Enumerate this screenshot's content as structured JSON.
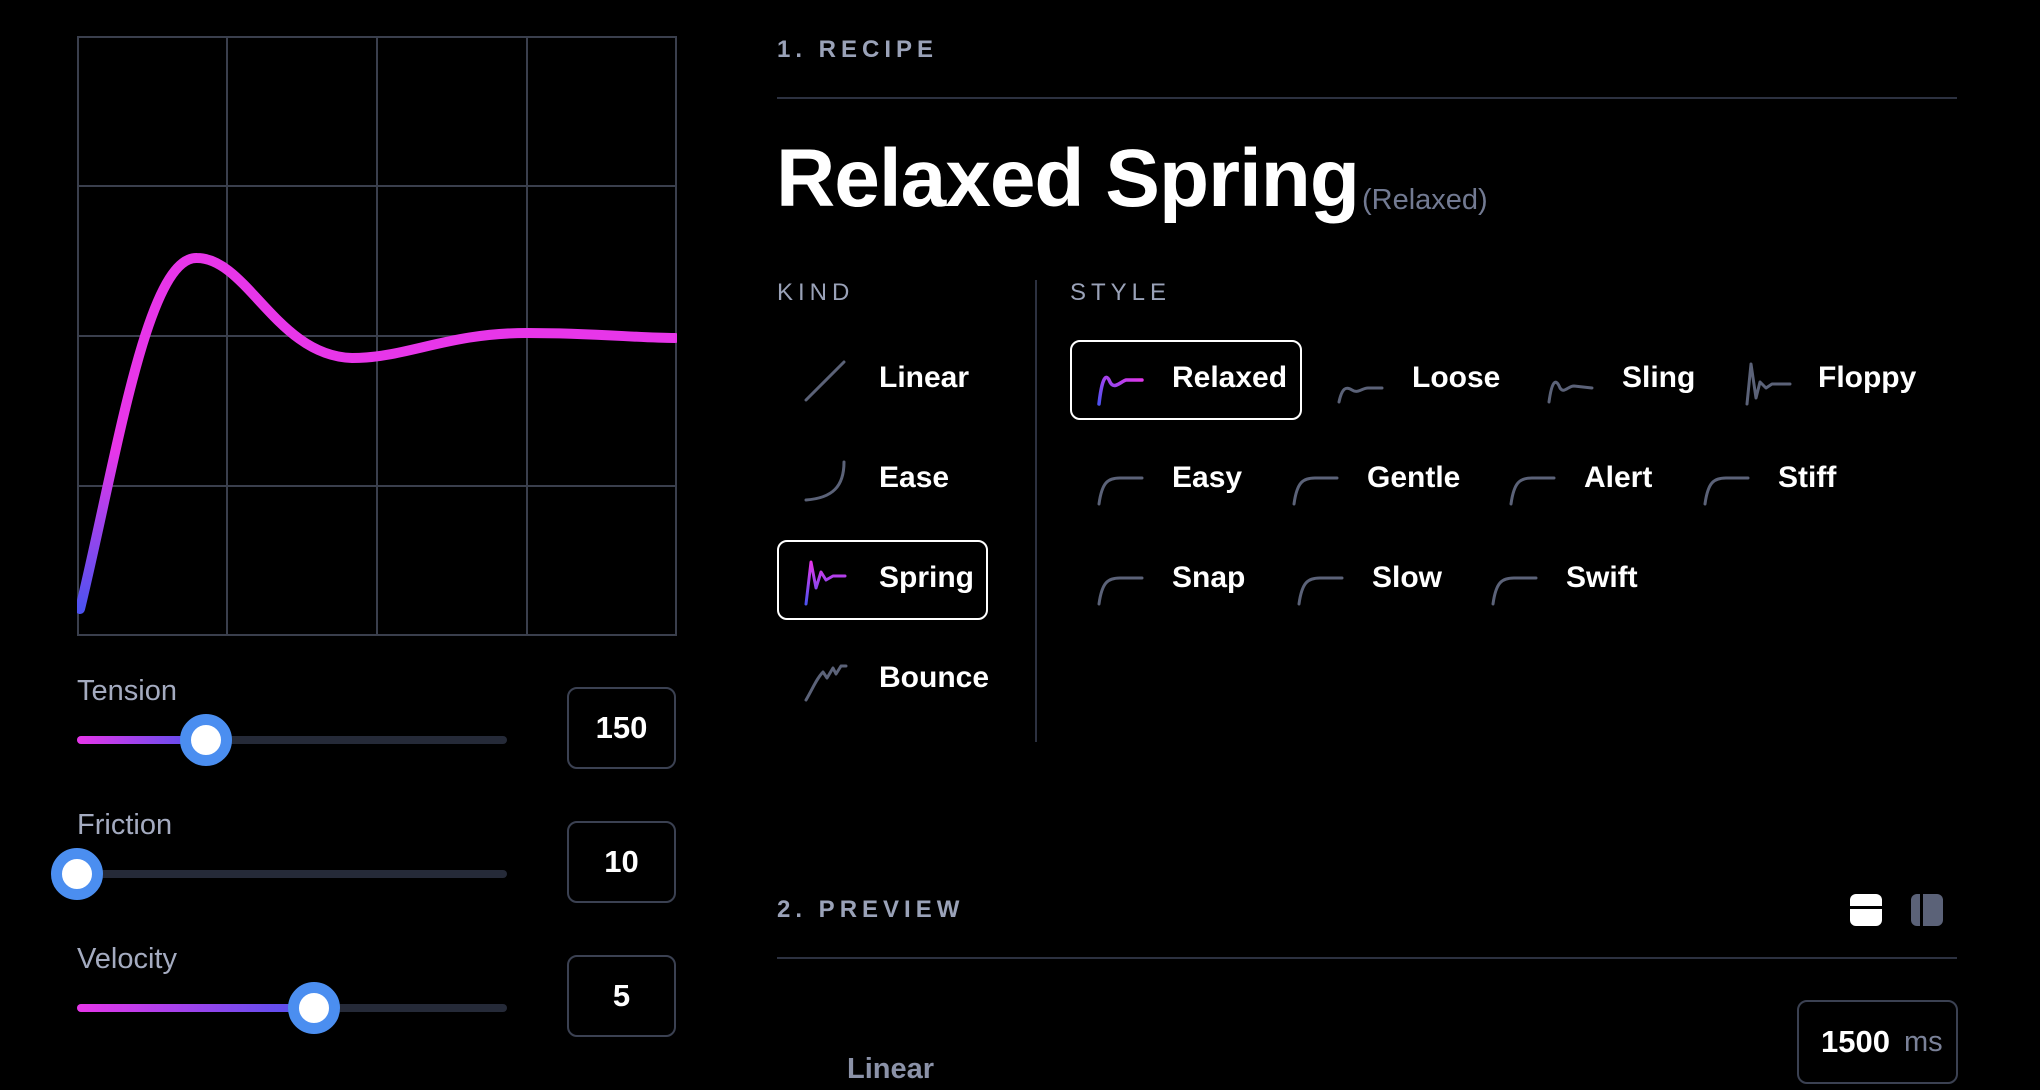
{
  "controls": {
    "tension": {
      "label": "Tension",
      "value": "150",
      "level": 0.3
    },
    "friction": {
      "label": "Friction",
      "value": "10",
      "level": 0.0
    },
    "velocity": {
      "label": "Velocity",
      "value": "5",
      "level": 0.55
    }
  },
  "recipe": {
    "section_title": "1. RECIPE",
    "title": "Relaxed Spring",
    "subtitle": "(Relaxed)",
    "kind_label": "KIND",
    "style_label": "STYLE",
    "kinds": [
      {
        "label": "Linear",
        "icon": "linear-curve-icon"
      },
      {
        "label": "Ease",
        "icon": "ease-curve-icon"
      },
      {
        "label": "Spring",
        "icon": "spring-curve-icon",
        "selected": true
      },
      {
        "label": "Bounce",
        "icon": "bounce-curve-icon"
      }
    ],
    "styles": [
      {
        "label": "Relaxed",
        "selected": true
      },
      {
        "label": "Loose"
      },
      {
        "label": "Sling"
      },
      {
        "label": "Floppy"
      },
      {
        "label": "Easy"
      },
      {
        "label": "Gentle"
      },
      {
        "label": "Alert"
      },
      {
        "label": "Stiff"
      },
      {
        "label": "Snap"
      },
      {
        "label": "Slow"
      },
      {
        "label": "Swift"
      }
    ]
  },
  "preview": {
    "section_title": "2. PREVIEW",
    "duration_value": "1500",
    "duration_unit": "ms",
    "row_label": "Linear"
  },
  "colors": {
    "accent_pink": "#e736e9",
    "accent_blue": "#4d52f0",
    "thumb_ring": "#4b8ef0",
    "background": "#000000"
  }
}
